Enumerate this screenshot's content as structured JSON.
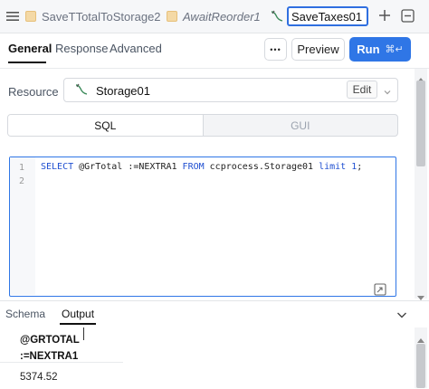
{
  "tabs": [
    {
      "label": "SaveTTotalToStorage2",
      "italic": false
    },
    {
      "label": "AwaitReorder1",
      "italic": true
    }
  ],
  "active_tab": {
    "rename_value": "SaveTaxes01"
  },
  "toolbar": {
    "tabs": [
      "General",
      "Response",
      "Advanced"
    ],
    "more_label": "•••",
    "preview_label": "Preview",
    "run_label": "Run",
    "run_shortcut": "⌘↵"
  },
  "resource": {
    "label": "Resource",
    "name": "Storage01",
    "edit_label": "Edit"
  },
  "mode": {
    "sql_label": "SQL",
    "gui_label": "GUI"
  },
  "editor": {
    "line_numbers": [
      "1",
      "2"
    ],
    "code": {
      "kw1": "SELECT",
      "part1": " @GrTotal :=NEXTRA1 ",
      "kw2": "FROM",
      "part2": " ccprocess.Storage01 ",
      "kw3": "limit",
      "sp": " ",
      "num": "1",
      "end": ";"
    }
  },
  "bottom": {
    "tabs": [
      "Schema",
      "Output"
    ],
    "column_header_line1": "@GRTOTAL",
    "column_header_line2": ":=NEXTRA1",
    "value": "5374.52"
  }
}
